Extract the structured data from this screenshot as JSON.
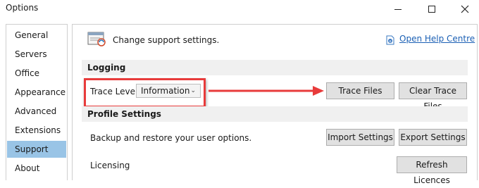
{
  "window": {
    "title": "Options"
  },
  "sidebar": {
    "items": [
      {
        "label": "General"
      },
      {
        "label": "Servers"
      },
      {
        "label": "Office"
      },
      {
        "label": "Appearance"
      },
      {
        "label": "Advanced"
      },
      {
        "label": "Extensions"
      },
      {
        "label": "Support",
        "active": true
      },
      {
        "label": "About"
      }
    ]
  },
  "header": {
    "text": "Change support settings.",
    "help_link": "Open Help Centre"
  },
  "logging": {
    "section_title": "Logging",
    "trace_level_label": "Trace Level",
    "trace_level_value": "Information",
    "trace_files_button": "Trace Files",
    "clear_trace_files_button": "Clear Trace Files"
  },
  "profile": {
    "section_title": "Profile Settings",
    "backup_text": "Backup and restore your user options.",
    "import_button": "Import Settings",
    "export_button": "Export Settings",
    "licensing_label": "Licensing",
    "refresh_licences_button": "Refresh Licences"
  },
  "colors": {
    "active_nav": "#99c4e6",
    "link": "#1a5fb4",
    "annotation": "#e83b3b"
  }
}
